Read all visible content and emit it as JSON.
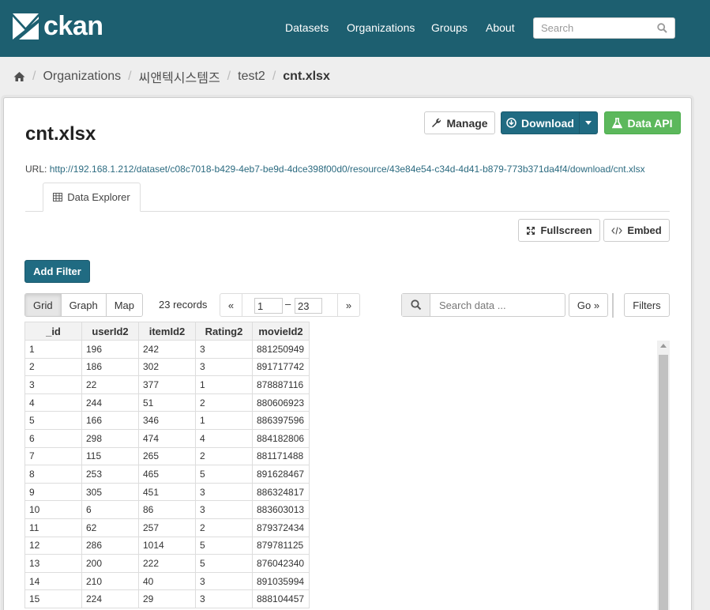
{
  "header": {
    "logo_text": "ckan",
    "nav": [
      "Datasets",
      "Organizations",
      "Groups",
      "About"
    ],
    "search_placeholder": "Search"
  },
  "breadcrumb": {
    "items": [
      "Organizations",
      "씨앤텍시스템즈",
      "test2"
    ],
    "current": "cnt.xlsx"
  },
  "resource": {
    "title": "cnt.xlsx",
    "url_label": "URL:",
    "url": "http://192.168.1.212/dataset/c08c7018-b429-4eb7-be9d-4dce398f00d0/resource/43e84e54-c34d-4d41-b879-773b371da4f4/download/cnt.xlsx",
    "manage_label": "Manage",
    "download_label": "Download",
    "data_api_label": "Data API"
  },
  "explorer": {
    "tab_label": "Data Explorer",
    "fullscreen_label": "Fullscreen",
    "embed_label": "Embed",
    "add_filter_label": "Add Filter",
    "views": [
      "Grid",
      "Graph",
      "Map"
    ],
    "active_view": "Grid",
    "records_label": "23 records",
    "pager_prev": "«",
    "pager_next": "»",
    "pager_from": "1",
    "pager_to": "23",
    "pager_dash": "–",
    "search_placeholder": "Search data ...",
    "go_label": "Go »",
    "filters_label": "Filters"
  },
  "grid": {
    "columns": [
      "_id",
      "userId2",
      "itemId2",
      "Rating2",
      "movieId2"
    ],
    "rows": [
      [
        "1",
        "196",
        "242",
        "3",
        "881250949"
      ],
      [
        "2",
        "186",
        "302",
        "3",
        "891717742"
      ],
      [
        "3",
        "22",
        "377",
        "1",
        "878887116"
      ],
      [
        "4",
        "244",
        "51",
        "2",
        "880606923"
      ],
      [
        "5",
        "166",
        "346",
        "1",
        "886397596"
      ],
      [
        "6",
        "298",
        "474",
        "4",
        "884182806"
      ],
      [
        "7",
        "115",
        "265",
        "2",
        "881171488"
      ],
      [
        "8",
        "253",
        "465",
        "5",
        "891628467"
      ],
      [
        "9",
        "305",
        "451",
        "3",
        "886324817"
      ],
      [
        "10",
        "6",
        "86",
        "3",
        "883603013"
      ],
      [
        "11",
        "62",
        "257",
        "2",
        "879372434"
      ],
      [
        "12",
        "286",
        "1014",
        "5",
        "879781125"
      ],
      [
        "13",
        "200",
        "222",
        "5",
        "876042340"
      ],
      [
        "14",
        "210",
        "40",
        "3",
        "891035994"
      ],
      [
        "15",
        "224",
        "29",
        "3",
        "888104457"
      ]
    ]
  },
  "colors": {
    "masthead": "#1d5f70",
    "primary": "#206b82",
    "success": "#5cb85c"
  }
}
